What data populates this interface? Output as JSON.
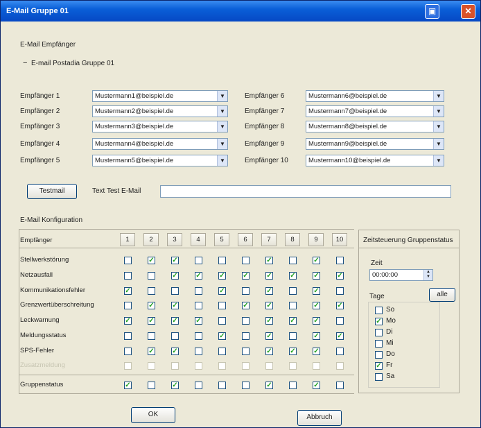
{
  "window": {
    "title": "E-Mail Gruppe 01",
    "help_icon": "window-help-icon",
    "close_icon": "window-close-icon"
  },
  "recipients_section": {
    "label": "E-Mail Empfänger",
    "group_collapse_icon": "minus-icon",
    "group_label": "E-mail Postadia Gruppe 01",
    "left": [
      {
        "label": "Empfänger 1",
        "value": "Mustermann1@beispiel.de"
      },
      {
        "label": "Empfänger 2",
        "value": "Mustermann2@beispiel.de"
      },
      {
        "label": "Empfänger 3",
        "value": "Mustermann3@beispiel.de"
      },
      {
        "label": "Empfänger 4",
        "value": "Mustermann4@beispiel.de"
      },
      {
        "label": "Empfänger 5",
        "value": "Mustermann5@beispiel.de"
      }
    ],
    "right": [
      {
        "label": "Empfänger 6",
        "value": "Mustermann6@beispiel.de"
      },
      {
        "label": "Empfänger 7",
        "value": "Mustermann7@beispiel.de"
      },
      {
        "label": "Empfänger 8",
        "value": "Mustermann8@beispiel.de"
      },
      {
        "label": "Empfänger 9",
        "value": "Mustermann9@beispiel.de"
      },
      {
        "label": "Empfänger 10",
        "value": "Mustermann10@beispiel.de"
      }
    ]
  },
  "test": {
    "button_label": "Testmail",
    "label": "Text Test E-Mail",
    "value": ""
  },
  "config": {
    "section_label": "E-Mail Konfiguration",
    "header_label": "Empfänger",
    "columns": [
      "1",
      "2",
      "3",
      "4",
      "5",
      "6",
      "7",
      "8",
      "9",
      "10"
    ],
    "rows": [
      {
        "label": "Stellwerkstörung",
        "checks": [
          false,
          true,
          true,
          false,
          false,
          false,
          true,
          false,
          true,
          false
        ]
      },
      {
        "label": "Netzausfall",
        "checks": [
          false,
          false,
          true,
          true,
          true,
          true,
          true,
          true,
          true,
          true
        ]
      },
      {
        "label": "Kommunikationsfehler",
        "checks": [
          true,
          false,
          false,
          false,
          true,
          false,
          true,
          false,
          true,
          false
        ]
      },
      {
        "label": "Grenzwertüberschreitung",
        "checks": [
          false,
          true,
          true,
          false,
          false,
          true,
          true,
          false,
          true,
          true
        ]
      },
      {
        "label": "Leckwarnung",
        "checks": [
          true,
          true,
          true,
          true,
          false,
          false,
          true,
          true,
          true,
          false
        ]
      },
      {
        "label": "Meldungsstatus",
        "checks": [
          false,
          false,
          false,
          false,
          true,
          false,
          true,
          false,
          true,
          true
        ]
      },
      {
        "label": "SPS-Fehler",
        "checks": [
          false,
          true,
          true,
          false,
          false,
          false,
          true,
          true,
          true,
          false
        ]
      },
      {
        "label": "Zusatzmeldung",
        "disabled": true,
        "checks": [
          false,
          false,
          false,
          false,
          false,
          false,
          false,
          false,
          false,
          false
        ]
      },
      {
        "label": "Gruppenstatus",
        "checks": [
          true,
          false,
          true,
          false,
          false,
          false,
          true,
          false,
          true,
          false
        ]
      }
    ]
  },
  "schedule": {
    "title": "Zeitsteuerung Gruppenstatus",
    "time_label": "Zeit",
    "time_value": "00:00:00",
    "days_label": "Tage",
    "all_button": "alle",
    "days": [
      {
        "label": "So",
        "checked": false
      },
      {
        "label": "Mo",
        "checked": true
      },
      {
        "label": "Di",
        "checked": false
      },
      {
        "label": "Mi",
        "checked": false
      },
      {
        "label": "Do",
        "checked": false
      },
      {
        "label": "Fr",
        "checked": true
      },
      {
        "label": "Sa",
        "checked": false
      }
    ]
  },
  "footer": {
    "ok_label": "OK",
    "cancel_label": "Abbruch"
  }
}
